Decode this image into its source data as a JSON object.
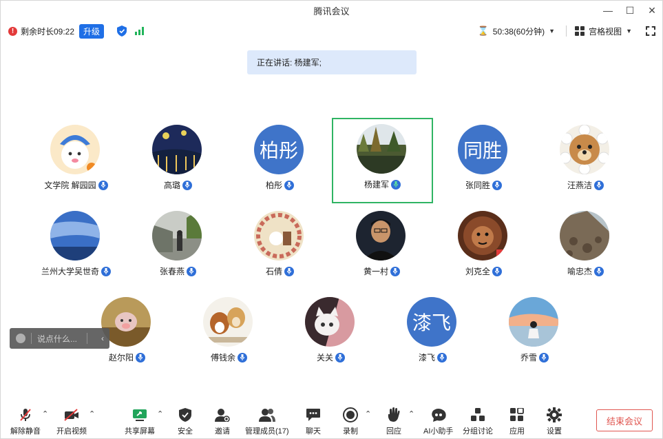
{
  "window": {
    "title": "腾讯会议"
  },
  "topbar": {
    "remaining": "剩余时长09:22",
    "upgrade": "升级",
    "timer": "50:38(60分钟)",
    "view_mode": "宫格视图"
  },
  "speaking": "正在讲话: 杨建军;",
  "participants": [
    {
      "name": "文学院 解园园",
      "avatar": "image",
      "active": false
    },
    {
      "name": "高璐",
      "avatar": "image",
      "active": false
    },
    {
      "name": "柏彤",
      "avatar": "柏彤",
      "active": false
    },
    {
      "name": "杨建军",
      "avatar": "image",
      "active": true
    },
    {
      "name": "张同胜",
      "avatar": "同胜",
      "active": false
    },
    {
      "name": "汪燕洁",
      "avatar": "image",
      "active": false
    },
    {
      "name": "兰州大学吴世奇",
      "avatar": "image",
      "active": false
    },
    {
      "name": "张春燕",
      "avatar": "image",
      "active": false
    },
    {
      "name": "石倩",
      "avatar": "image",
      "active": false
    },
    {
      "name": "黄一村",
      "avatar": "image",
      "active": false
    },
    {
      "name": "刘克全",
      "avatar": "image",
      "active": false
    },
    {
      "name": "喻忠杰",
      "avatar": "image",
      "active": false
    },
    {
      "name": "赵尔阳",
      "avatar": "image",
      "active": false
    },
    {
      "name": "傅钱余",
      "avatar": "image",
      "active": false
    },
    {
      "name": "关关",
      "avatar": "image",
      "active": false
    },
    {
      "name": "漆飞",
      "avatar": "漆飞",
      "active": false
    },
    {
      "name": "乔雪",
      "avatar": "image",
      "active": false
    }
  ],
  "chat": {
    "placeholder": "说点什么..."
  },
  "bottombar": {
    "unmute": "解除静音",
    "start_video": "开启视频",
    "share_screen": "共享屏幕",
    "security": "安全",
    "invite": "邀请",
    "manage_members": "管理成员(17)",
    "chat": "聊天",
    "record": "录制",
    "react": "回应",
    "ai_assistant": "AI小助手",
    "breakout": "分组讨论",
    "apps": "应用",
    "settings": "设置",
    "end_meeting": "结束会议"
  },
  "colors": {
    "accent": "#1f6fe6",
    "active_border": "#2fb463",
    "end": "#e0554f",
    "avatar_text_bg": "#3f74c9"
  }
}
